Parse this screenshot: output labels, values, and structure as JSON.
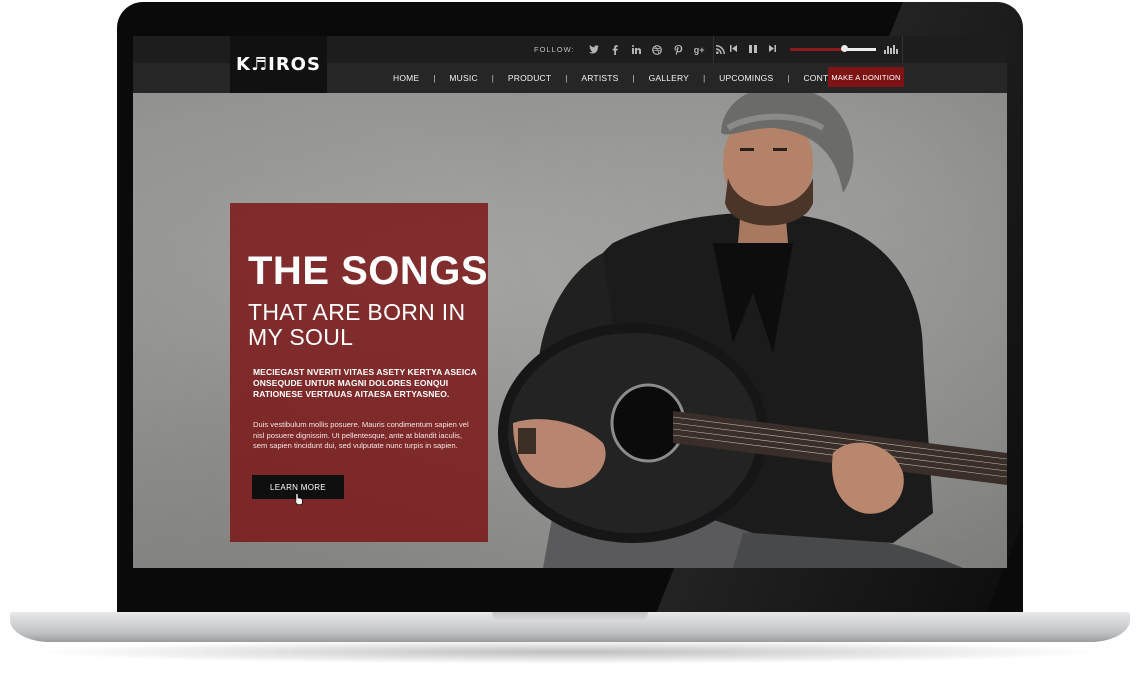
{
  "brand": {
    "logo": "K♬IROS"
  },
  "topbar": {
    "follow_label": "FOLLOW:",
    "social_icons": [
      "twitter-icon",
      "facebook-icon",
      "linkedin-icon",
      "dribbble-icon",
      "pinterest-icon",
      "google-plus-icon",
      "rss-icon"
    ],
    "player": {
      "progress": 0.63
    }
  },
  "nav": {
    "items": [
      "HOME",
      "MUSIC",
      "PRODUCT",
      "ARTISTS",
      "GALLERY",
      "UPCOMINGS",
      "CONTACT US"
    ],
    "donate_label": "MAKE A DONITION"
  },
  "hero": {
    "title": "THE SONGS",
    "subtitle": "THAT ARE BORN IN MY SOUL",
    "caps_text": "MECIEGAST NVERITI VITAES ASETY KERTYA ASEICA ONSEQUDE UNTUR MAGNI DOLORES EONQUI RATIONESE VERTAUAS AITAESA ERTYASNEO.",
    "body_text": "Duis vestibulum mollis posuere. Mauris condimentum sapien vel nisl posuere dignissim. Ut pellentesque, ante at blandit iaculis, sem sapien tincidunt dui, sed vulputate nunc turpis in sapien.",
    "button_label": "LEARN MORE"
  },
  "colors": {
    "accent": "#7f1414",
    "panel": "#7a1214",
    "dark": "#1d1d1d"
  }
}
